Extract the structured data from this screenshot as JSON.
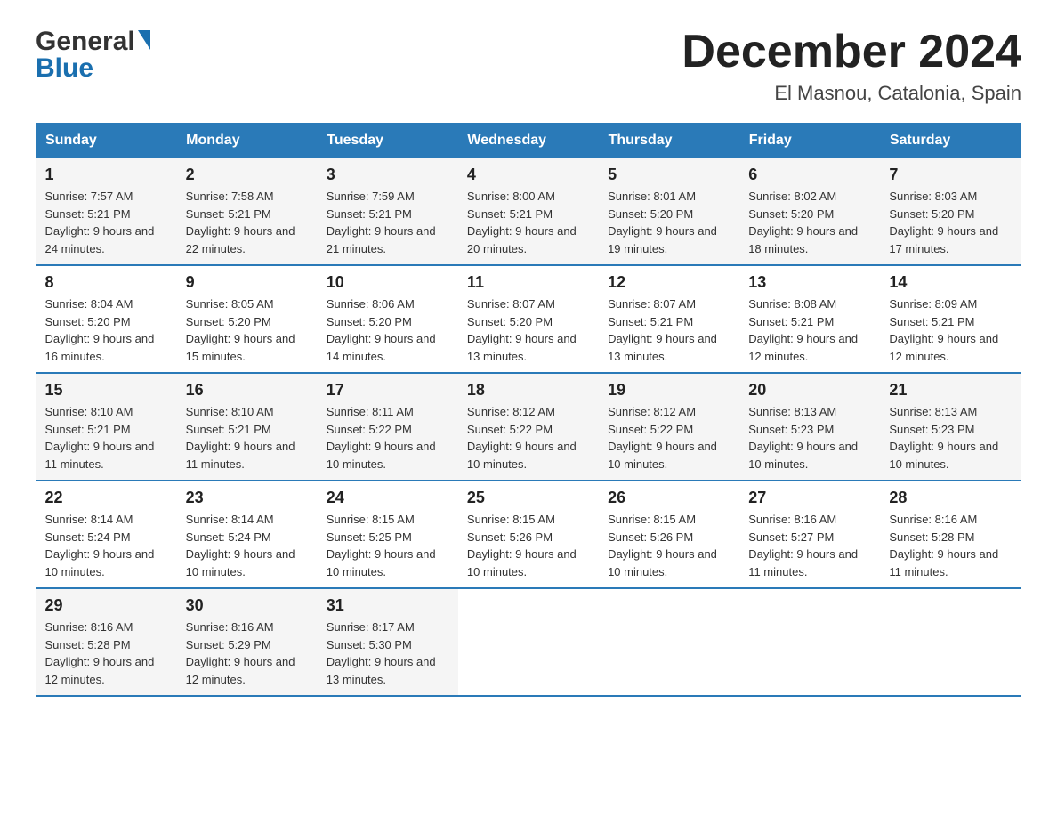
{
  "logo": {
    "line1": "General",
    "arrow": "▶",
    "line2": "Blue"
  },
  "title": "December 2024",
  "location": "El Masnou, Catalonia, Spain",
  "days_of_week": [
    "Sunday",
    "Monday",
    "Tuesday",
    "Wednesday",
    "Thursday",
    "Friday",
    "Saturday"
  ],
  "weeks": [
    [
      {
        "day": "1",
        "sunrise": "Sunrise: 7:57 AM",
        "sunset": "Sunset: 5:21 PM",
        "daylight": "Daylight: 9 hours and 24 minutes."
      },
      {
        "day": "2",
        "sunrise": "Sunrise: 7:58 AM",
        "sunset": "Sunset: 5:21 PM",
        "daylight": "Daylight: 9 hours and 22 minutes."
      },
      {
        "day": "3",
        "sunrise": "Sunrise: 7:59 AM",
        "sunset": "Sunset: 5:21 PM",
        "daylight": "Daylight: 9 hours and 21 minutes."
      },
      {
        "day": "4",
        "sunrise": "Sunrise: 8:00 AM",
        "sunset": "Sunset: 5:21 PM",
        "daylight": "Daylight: 9 hours and 20 minutes."
      },
      {
        "day": "5",
        "sunrise": "Sunrise: 8:01 AM",
        "sunset": "Sunset: 5:20 PM",
        "daylight": "Daylight: 9 hours and 19 minutes."
      },
      {
        "day": "6",
        "sunrise": "Sunrise: 8:02 AM",
        "sunset": "Sunset: 5:20 PM",
        "daylight": "Daylight: 9 hours and 18 minutes."
      },
      {
        "day": "7",
        "sunrise": "Sunrise: 8:03 AM",
        "sunset": "Sunset: 5:20 PM",
        "daylight": "Daylight: 9 hours and 17 minutes."
      }
    ],
    [
      {
        "day": "8",
        "sunrise": "Sunrise: 8:04 AM",
        "sunset": "Sunset: 5:20 PM",
        "daylight": "Daylight: 9 hours and 16 minutes."
      },
      {
        "day": "9",
        "sunrise": "Sunrise: 8:05 AM",
        "sunset": "Sunset: 5:20 PM",
        "daylight": "Daylight: 9 hours and 15 minutes."
      },
      {
        "day": "10",
        "sunrise": "Sunrise: 8:06 AM",
        "sunset": "Sunset: 5:20 PM",
        "daylight": "Daylight: 9 hours and 14 minutes."
      },
      {
        "day": "11",
        "sunrise": "Sunrise: 8:07 AM",
        "sunset": "Sunset: 5:20 PM",
        "daylight": "Daylight: 9 hours and 13 minutes."
      },
      {
        "day": "12",
        "sunrise": "Sunrise: 8:07 AM",
        "sunset": "Sunset: 5:21 PM",
        "daylight": "Daylight: 9 hours and 13 minutes."
      },
      {
        "day": "13",
        "sunrise": "Sunrise: 8:08 AM",
        "sunset": "Sunset: 5:21 PM",
        "daylight": "Daylight: 9 hours and 12 minutes."
      },
      {
        "day": "14",
        "sunrise": "Sunrise: 8:09 AM",
        "sunset": "Sunset: 5:21 PM",
        "daylight": "Daylight: 9 hours and 12 minutes."
      }
    ],
    [
      {
        "day": "15",
        "sunrise": "Sunrise: 8:10 AM",
        "sunset": "Sunset: 5:21 PM",
        "daylight": "Daylight: 9 hours and 11 minutes."
      },
      {
        "day": "16",
        "sunrise": "Sunrise: 8:10 AM",
        "sunset": "Sunset: 5:21 PM",
        "daylight": "Daylight: 9 hours and 11 minutes."
      },
      {
        "day": "17",
        "sunrise": "Sunrise: 8:11 AM",
        "sunset": "Sunset: 5:22 PM",
        "daylight": "Daylight: 9 hours and 10 minutes."
      },
      {
        "day": "18",
        "sunrise": "Sunrise: 8:12 AM",
        "sunset": "Sunset: 5:22 PM",
        "daylight": "Daylight: 9 hours and 10 minutes."
      },
      {
        "day": "19",
        "sunrise": "Sunrise: 8:12 AM",
        "sunset": "Sunset: 5:22 PM",
        "daylight": "Daylight: 9 hours and 10 minutes."
      },
      {
        "day": "20",
        "sunrise": "Sunrise: 8:13 AM",
        "sunset": "Sunset: 5:23 PM",
        "daylight": "Daylight: 9 hours and 10 minutes."
      },
      {
        "day": "21",
        "sunrise": "Sunrise: 8:13 AM",
        "sunset": "Sunset: 5:23 PM",
        "daylight": "Daylight: 9 hours and 10 minutes."
      }
    ],
    [
      {
        "day": "22",
        "sunrise": "Sunrise: 8:14 AM",
        "sunset": "Sunset: 5:24 PM",
        "daylight": "Daylight: 9 hours and 10 minutes."
      },
      {
        "day": "23",
        "sunrise": "Sunrise: 8:14 AM",
        "sunset": "Sunset: 5:24 PM",
        "daylight": "Daylight: 9 hours and 10 minutes."
      },
      {
        "day": "24",
        "sunrise": "Sunrise: 8:15 AM",
        "sunset": "Sunset: 5:25 PM",
        "daylight": "Daylight: 9 hours and 10 minutes."
      },
      {
        "day": "25",
        "sunrise": "Sunrise: 8:15 AM",
        "sunset": "Sunset: 5:26 PM",
        "daylight": "Daylight: 9 hours and 10 minutes."
      },
      {
        "day": "26",
        "sunrise": "Sunrise: 8:15 AM",
        "sunset": "Sunset: 5:26 PM",
        "daylight": "Daylight: 9 hours and 10 minutes."
      },
      {
        "day": "27",
        "sunrise": "Sunrise: 8:16 AM",
        "sunset": "Sunset: 5:27 PM",
        "daylight": "Daylight: 9 hours and 11 minutes."
      },
      {
        "day": "28",
        "sunrise": "Sunrise: 8:16 AM",
        "sunset": "Sunset: 5:28 PM",
        "daylight": "Daylight: 9 hours and 11 minutes."
      }
    ],
    [
      {
        "day": "29",
        "sunrise": "Sunrise: 8:16 AM",
        "sunset": "Sunset: 5:28 PM",
        "daylight": "Daylight: 9 hours and 12 minutes."
      },
      {
        "day": "30",
        "sunrise": "Sunrise: 8:16 AM",
        "sunset": "Sunset: 5:29 PM",
        "daylight": "Daylight: 9 hours and 12 minutes."
      },
      {
        "day": "31",
        "sunrise": "Sunrise: 8:17 AM",
        "sunset": "Sunset: 5:30 PM",
        "daylight": "Daylight: 9 hours and 13 minutes."
      },
      null,
      null,
      null,
      null
    ]
  ],
  "colors": {
    "header_bg": "#2a7ab8",
    "header_text": "#ffffff",
    "border": "#2a7ab8",
    "title": "#222222",
    "location": "#444444",
    "day_number": "#222222",
    "cell_text": "#333333"
  }
}
